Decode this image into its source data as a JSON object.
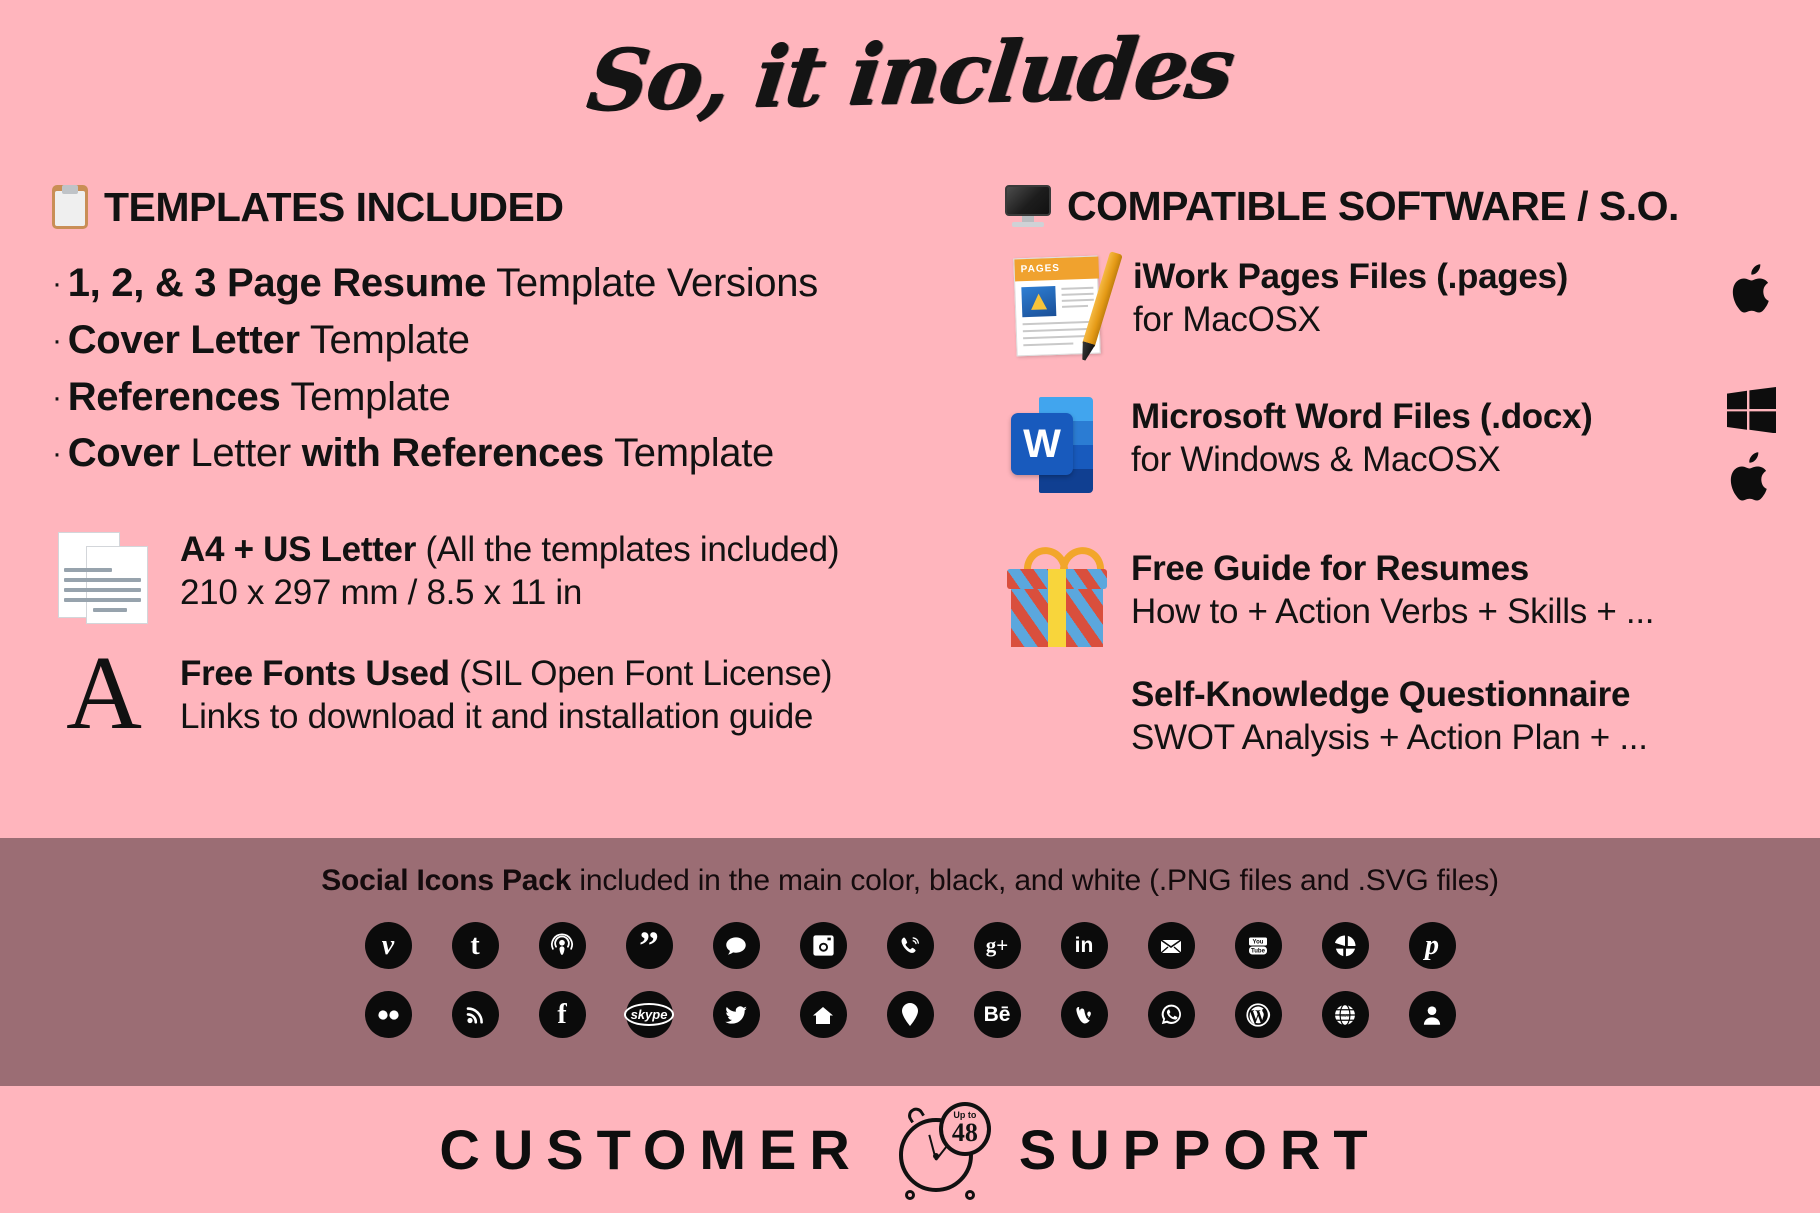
{
  "colors": {
    "background_pink": "#FFB5BD",
    "band_mauve": "#9B6D74",
    "text_black": "#121212"
  },
  "title": "So, it includes",
  "left_column": {
    "heading": "TEMPLATES INCLUDED",
    "heading_icon": "clipboard-icon",
    "bullets": [
      {
        "bold": "1, 2, & 3 Page Resume",
        "light": " Template Versions",
        "bold2": "",
        "light2": ""
      },
      {
        "bold": "Cover Letter",
        "light": " Template",
        "bold2": "",
        "light2": ""
      },
      {
        "bold": "References",
        "light": " Template",
        "bold2": "",
        "light2": ""
      },
      {
        "bold": "Cover",
        "light": " Letter ",
        "bold2": "with References",
        "light2": " Template"
      }
    ],
    "features": [
      {
        "icon": "a4-pages-icon",
        "title": "A4 + US Letter",
        "title_light": " (All the templates included)",
        "subtitle": "210 x 297 mm / 8.5 x 11 in"
      },
      {
        "icon": "serif-a-icon",
        "icon_glyph": "A",
        "title": "Free Fonts Used",
        "title_light": " (SIL Open Font License)",
        "subtitle": "Links to download it and installation guide"
      }
    ]
  },
  "right_column": {
    "heading": "COMPATIBLE SOFTWARE / S.O.",
    "heading_icon": "monitor-icon",
    "rows": [
      {
        "icon": "pages-app-icon",
        "icon_label": "PAGES",
        "title": "iWork Pages Files (.pages)",
        "subtitle": "for MacOSX",
        "os_icons": [
          "apple-logo-icon"
        ]
      },
      {
        "icon": "word-app-icon",
        "icon_letter": "W",
        "title": "Microsoft Word Files (.docx)",
        "subtitle": "for Windows & MacOSX",
        "os_icons": [
          "windows-logo-icon",
          "apple-logo-icon"
        ]
      },
      {
        "icon": "gift-icon",
        "title": "Free Guide for Resumes",
        "subtitle": "How to + Action Verbs + Skills + ...",
        "os_icons": []
      },
      {
        "icon": "none",
        "title": "Self-Knowledge Questionnaire",
        "subtitle": "SWOT Analysis + Action Plan + ...",
        "os_icons": []
      }
    ]
  },
  "social_band": {
    "title_bold": "Social Icons Pack",
    "title_light": " included in the main color, black, and white (.PNG files and .SVG files)",
    "row1": [
      "vimeo-icon",
      "tumblr-icon",
      "podcast-icon",
      "quote-icon",
      "chat-bubble-icon",
      "instagram-icon",
      "viber-phone-icon",
      "google-plus-icon",
      "linkedin-icon",
      "email-icon",
      "youtube-icon",
      "picasa-icon",
      "pinterest-icon"
    ],
    "row2": [
      "flickr-icon",
      "rss-icon",
      "facebook-icon",
      "skype-icon",
      "twitter-icon",
      "home-icon",
      "location-pin-icon",
      "behance-icon",
      "vine-icon",
      "whatsapp-icon",
      "wordpress-icon",
      "www-globe-icon",
      "user-icon"
    ],
    "row1_labels": [
      "v",
      "t",
      "",
      "”",
      "",
      "",
      "",
      "g+",
      "in",
      "",
      "You Tube",
      "",
      "p"
    ],
    "row2_labels": [
      "",
      "",
      "f",
      "skype",
      "",
      "",
      "",
      "Bē",
      "",
      "",
      "",
      "www",
      ""
    ]
  },
  "footer": {
    "left_word": "CUSTOMER",
    "right_word": "SUPPORT",
    "clock_icon": "alarm-clock-icon",
    "badge_small": "Up to",
    "badge_number": "48"
  }
}
